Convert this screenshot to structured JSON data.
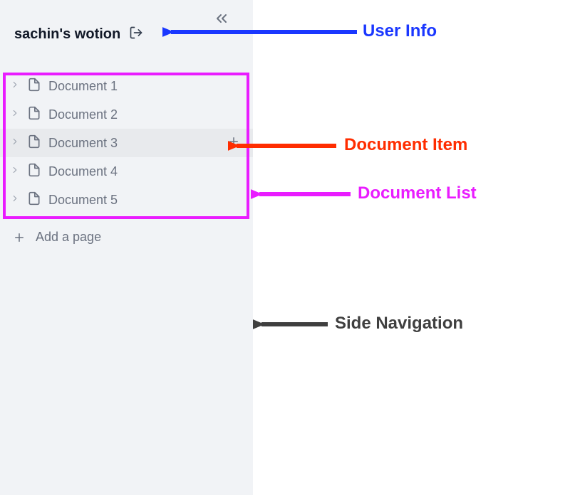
{
  "sidebar": {
    "user": {
      "name": "sachin's wotion"
    },
    "documents": [
      {
        "label": "Document 1",
        "hovered": false
      },
      {
        "label": "Document 2",
        "hovered": false
      },
      {
        "label": "Document 3",
        "hovered": true
      },
      {
        "label": "Document 4",
        "hovered": false
      },
      {
        "label": "Document 5",
        "hovered": false
      }
    ],
    "add_page_label": "Add a page"
  },
  "annotations": {
    "user_info": {
      "text": "User Info",
      "color": "#1a37ff"
    },
    "document_item": {
      "text": "Document Item",
      "color": "#ff2d00"
    },
    "document_list": {
      "text": "Document List",
      "color": "#e91cff"
    },
    "side_nav": {
      "text": "Side Navigation",
      "color": "#3f3f3f"
    }
  }
}
